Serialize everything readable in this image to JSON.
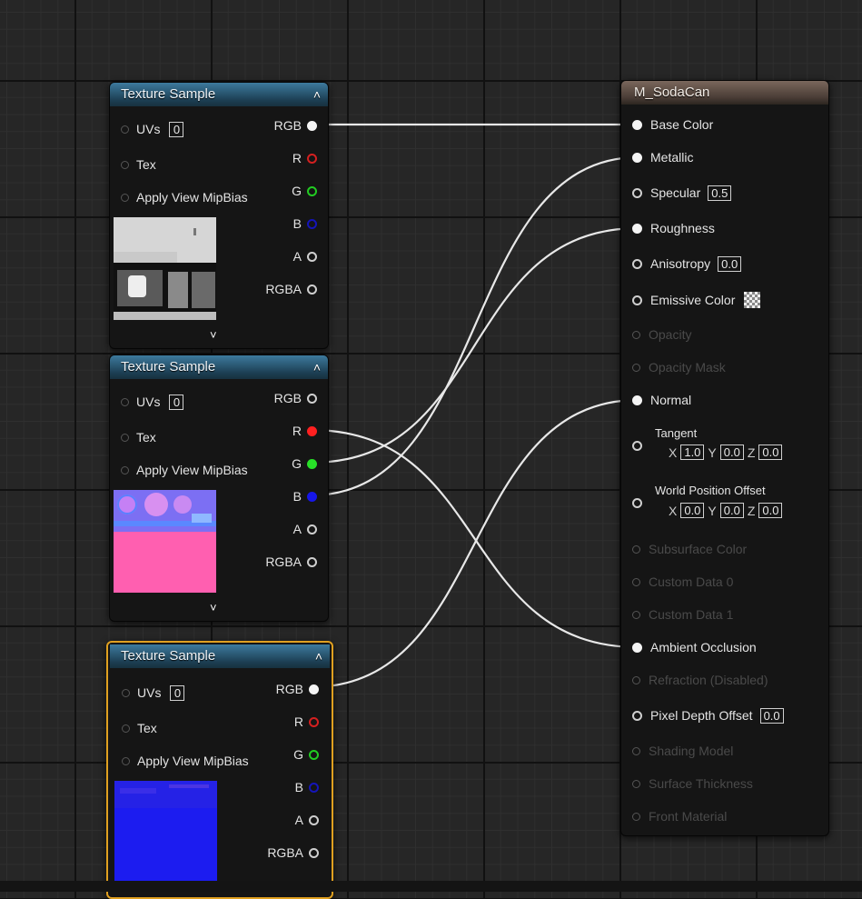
{
  "texture_nodes": [
    {
      "title": "Texture Sample",
      "inputs": [
        {
          "label": "UVs",
          "value": "0"
        },
        {
          "label": "Tex"
        },
        {
          "label": "Apply View MipBias"
        }
      ],
      "outputs": [
        {
          "label": "RGB"
        },
        {
          "label": "R"
        },
        {
          "label": "G"
        },
        {
          "label": "B"
        },
        {
          "label": "A"
        },
        {
          "label": "RGBA"
        }
      ],
      "collapse_icon": "chevron-up-icon",
      "expand_icon": "chevron-down-icon"
    },
    {
      "title": "Texture Sample",
      "inputs": [
        {
          "label": "UVs",
          "value": "0"
        },
        {
          "label": "Tex"
        },
        {
          "label": "Apply View MipBias"
        }
      ],
      "outputs": [
        {
          "label": "RGB"
        },
        {
          "label": "R"
        },
        {
          "label": "G"
        },
        {
          "label": "B"
        },
        {
          "label": "A"
        },
        {
          "label": "RGBA"
        }
      ],
      "collapse_icon": "chevron-up-icon",
      "expand_icon": "chevron-down-icon"
    },
    {
      "title": "Texture Sample",
      "inputs": [
        {
          "label": "UVs",
          "value": "0"
        },
        {
          "label": "Tex"
        },
        {
          "label": "Apply View MipBias"
        }
      ],
      "outputs": [
        {
          "label": "RGB"
        },
        {
          "label": "R"
        },
        {
          "label": "G"
        },
        {
          "label": "B"
        },
        {
          "label": "A"
        },
        {
          "label": "RGBA"
        }
      ],
      "collapse_icon": "chevron-up-icon",
      "selected": true
    }
  ],
  "material_node": {
    "title": "M_SodaCan",
    "pins": [
      {
        "label": "Base Color"
      },
      {
        "label": "Metallic"
      },
      {
        "label": "Specular",
        "value": "0.5"
      },
      {
        "label": "Roughness"
      },
      {
        "label": "Anisotropy",
        "value": "0.0"
      },
      {
        "label": "Emissive Color"
      },
      {
        "label": "Opacity"
      },
      {
        "label": "Opacity Mask"
      },
      {
        "label": "Normal"
      },
      {
        "label": "Tangent",
        "x": "1.0",
        "y": "0.0",
        "z": "0.0"
      },
      {
        "label": "World Position Offset",
        "x": "0.0",
        "y": "0.0",
        "z": "0.0"
      },
      {
        "label": "Subsurface Color"
      },
      {
        "label": "Custom Data 0"
      },
      {
        "label": "Custom Data 1"
      },
      {
        "label": "Ambient Occlusion"
      },
      {
        "label": "Refraction (Disabled)"
      },
      {
        "label": "Pixel Depth Offset",
        "value": "0.0"
      },
      {
        "label": "Shading Model"
      },
      {
        "label": "Surface Thickness"
      },
      {
        "label": "Front Material"
      }
    ],
    "axis_labels": {
      "x": "X",
      "y": "Y",
      "z": "Z"
    }
  },
  "connections": [
    {
      "from": "texture-1.RGB",
      "to": "Base Color"
    },
    {
      "from": "texture-2.R",
      "to": "Ambient Occlusion"
    },
    {
      "from": "texture-2.G",
      "to": "Roughness"
    },
    {
      "from": "texture-2.B",
      "to": "Metallic"
    },
    {
      "from": "texture-3.RGB",
      "to": "Normal"
    }
  ],
  "colors": {
    "selection_outline": "#e0a020",
    "texture_header": "#2a5a78",
    "material_header": "#5c4c43",
    "pin_red": "#ff2020",
    "pin_green": "#28e028",
    "pin_blue": "#1616e8",
    "wire": "#e8e8e8"
  }
}
